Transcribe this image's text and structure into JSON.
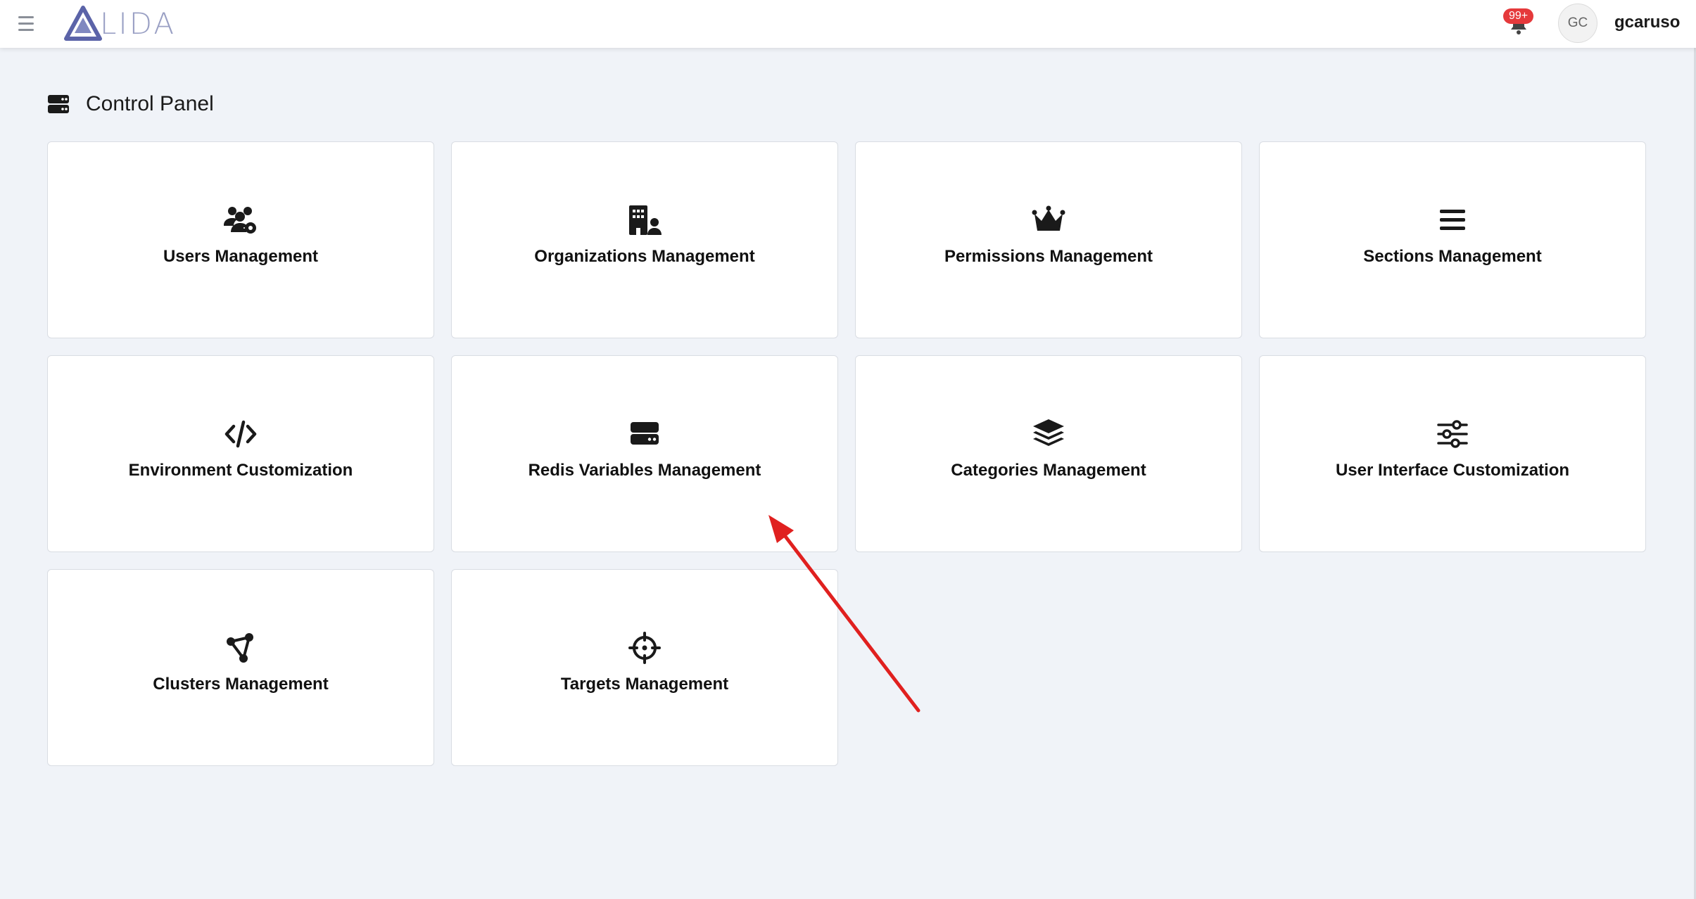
{
  "header": {
    "logo_text": "LIDA",
    "notification_badge": "99+",
    "avatar_initials": "GC",
    "username": "gcaruso"
  },
  "page": {
    "title": "Control Panel"
  },
  "cards": [
    {
      "label": "Users Management",
      "icon": "users-gear-icon"
    },
    {
      "label": "Organizations Management",
      "icon": "building-user-icon"
    },
    {
      "label": "Permissions Management",
      "icon": "crown-icon"
    },
    {
      "label": "Sections Management",
      "icon": "bars-icon"
    },
    {
      "label": "Environment Customization",
      "icon": "code-icon"
    },
    {
      "label": "Redis Variables Management",
      "icon": "server-icon"
    },
    {
      "label": "Categories Management",
      "icon": "layer-group-icon"
    },
    {
      "label": "User Interface Customization",
      "icon": "sliders-icon"
    },
    {
      "label": "Clusters Management",
      "icon": "cluster-nodes-icon"
    },
    {
      "label": "Targets Management",
      "icon": "crosshairs-icon"
    }
  ],
  "colors": {
    "background": "#f0f3f8",
    "card": "#ffffff",
    "badge": "#e5393b",
    "annotation_arrow": "#e0201f",
    "logo": "#9aa0c4"
  }
}
